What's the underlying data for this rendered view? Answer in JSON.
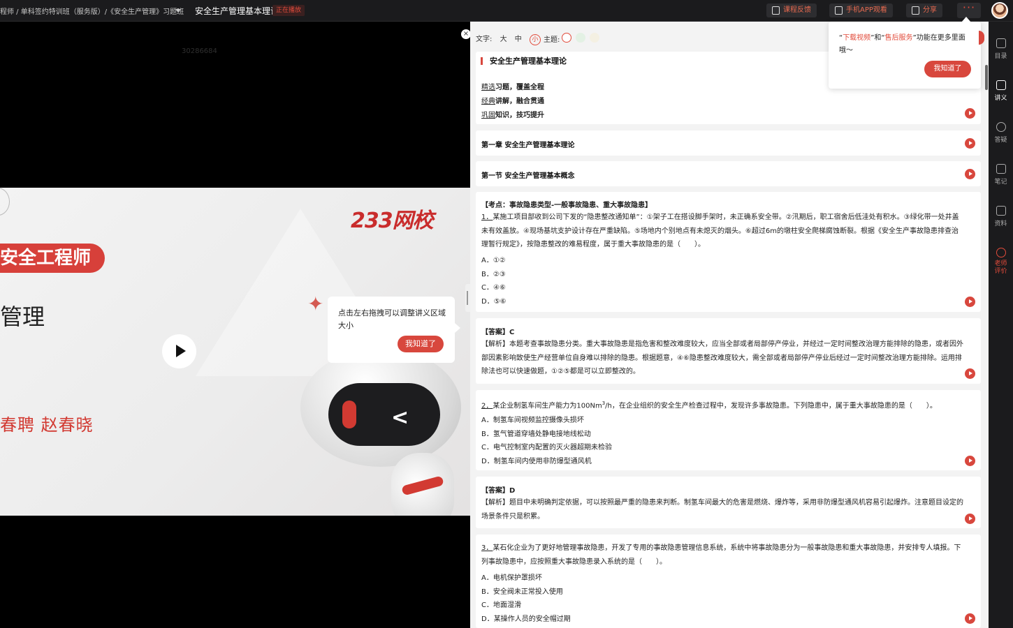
{
  "topbar": {
    "breadcrumb": "程师 / 单科签约特训班（服务版）/《安全生产管理》习题班",
    "now_title": "安全生产管理基本理论",
    "now_badge": "正在播放",
    "feedback_label": "课程反馈",
    "app_watch_label": "手机APP观看",
    "share_label": "分享",
    "more_label": "···"
  },
  "video": {
    "id_watermark": "30286684",
    "logo_text": "233网校",
    "pill_text": "安全工程师",
    "big_text": "管理",
    "teachers": "春聘    赵春晓"
  },
  "tip_popup": {
    "text": "点击左右拖拽可以调整讲义区域大小",
    "ok_label": "我知道了"
  },
  "notes": {
    "controls": {
      "font_label": "文字:",
      "size_large": "大",
      "size_medium": "中",
      "size_small": "小",
      "theme_label": "主题:",
      "theme_colors": [
        "#ffffff",
        "#e3f1e4",
        "#f4f0e2"
      ]
    },
    "intro": {
      "heading": "安全生产管理基本理论",
      "lines": [
        {
          "u": "精选",
          "rest": "习题，覆盖全程"
        },
        {
          "u": "经典",
          "rest": "讲解，融合贯通"
        },
        {
          "u": "巩固",
          "rest": "知识，技巧提升"
        }
      ]
    },
    "chapter": "第一章 安全生产管理基本理论",
    "section": "第一节 安全生产管理基本概念",
    "q1": {
      "topic": "【考点：事故隐患类型-一般事故隐患、重大事故隐患】",
      "num": "1．",
      "stem": "某施工项目部收到公司下发的“隐患整改通知单”：①架子工在搭设脚手架时，未正确系安全带。②汛期后，职工宿舍后低洼处有积水。③绿化带一处井盖未有效盖放。④现场基坑支护设计存在严重缺陷。⑤场地内个别地点有未熄灭的烟头。⑥超过6m的墩柱安全爬梯腐蚀断裂。根据《安全生产事故隐患排查治理暂行规定》，按隐患整改的难易程度，属于重大事故隐患的是（　　）。",
      "options": [
        "A．①②",
        "B．②③",
        "C．④⑥",
        "D．⑤⑥"
      ]
    },
    "a1": {
      "answer": "【答案】C",
      "analysis": "【解析】本题考查事故隐患分类。重大事故隐患是指危害和整改难度较大，应当全部或者局部停产停业，并经过一定时间整改治理方能排除的隐患，或者因外部因素影响致使生产经营单位自身难以排除的隐患。根据题意，④⑥隐患整改难度较大，需全部或者局部停产停业后经过一定时间整改治理方能排除。运用排除法也可以快速做题，①②⑤都是可以立即整改的。"
    },
    "q2": {
      "num": "2．",
      "stem_a": "某企业制氢车间生产能力为100Nm",
      "stem_sup": "3",
      "stem_b": "/h，在企业组织的安全生产检查过程中，发现许多事故隐患。下列隐患中，属于重大事故隐患的是（　　）。",
      "options": [
        "A．制氢车间视频监控摄像头损坏",
        "B．氢气管道穿墙处静电接地线松动",
        "C．电气控制室内配置的灭火器超期未检验",
        "D．制氢车间内使用非防爆型通风机"
      ]
    },
    "a2": {
      "answer": "【答案】D",
      "analysis": "【解析】题目中未明确判定依据，可以按照最严重的隐患来判断。制氢车间最大的危害是燃烧、爆炸等，采用非防爆型通风机容易引起爆炸。注意题目设定的场景条件只是积累。"
    },
    "q3": {
      "num": "3．",
      "stem": "某石化企业为了更好地管理事故隐患，开发了专用的事故隐患管理信息系统，系统中将事故隐患分为一般事故隐患和重大事故隐患，并安排专人填报。下列事故隐患中，应按照重大事故隐患录入系统的是（　　）。",
      "options": [
        "A．电机保护罩损坏",
        "B．安全阀未正常投入使用",
        "C．地面湿滑",
        "D．某操作人员的安全帽过期"
      ]
    }
  },
  "download_popup": {
    "q1": "“",
    "hl1": "下载视频",
    "mid": "”和“",
    "hl2": "售后服务",
    "tail": "”功能在更多里面哦～",
    "ok_label": "我知道了"
  },
  "rail": {
    "items": [
      "目录",
      "讲义",
      "答疑",
      "笔记",
      "资料",
      "老师评价"
    ]
  }
}
